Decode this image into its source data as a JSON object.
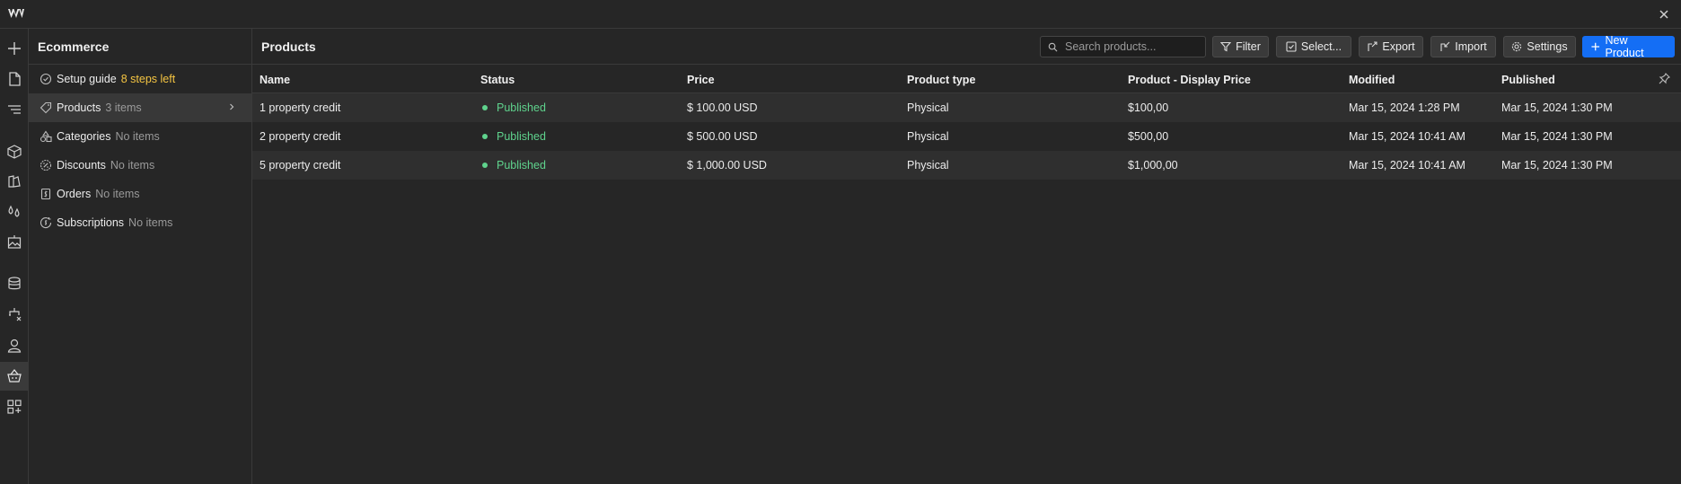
{
  "colors": {
    "accent": "#146ef5",
    "published": "#5fd38d",
    "warning": "#f5c542"
  },
  "sidebar": {
    "title": "Ecommerce",
    "items": [
      {
        "label": "Setup guide",
        "count": "8 steps left",
        "icon": "check-circle-icon"
      },
      {
        "label": "Products",
        "count": "3 items",
        "icon": "tag-icon"
      },
      {
        "label": "Categories",
        "count": "No items",
        "icon": "categories-icon"
      },
      {
        "label": "Discounts",
        "count": "No items",
        "icon": "discount-icon"
      },
      {
        "label": "Orders",
        "count": "No items",
        "icon": "orders-icon"
      },
      {
        "label": "Subscriptions",
        "count": "No items",
        "icon": "subscriptions-icon"
      }
    ]
  },
  "rail": [
    "add-icon",
    "page-icon",
    "navigator-icon",
    "components-icon",
    "style-icon",
    "variables-icon",
    "assets-icon",
    "cms-icon",
    "logic-icon",
    "users-icon",
    "ecommerce-icon",
    "apps-icon"
  ],
  "main": {
    "title": "Products",
    "search_placeholder": "Search products...",
    "buttons": {
      "filter": "Filter",
      "select": "Select...",
      "export": "Export",
      "import": "Import",
      "settings": "Settings",
      "new_product": "New Product"
    }
  },
  "table": {
    "columns": [
      "Name",
      "Status",
      "Price",
      "Product type",
      "Product - Display Price",
      "Modified",
      "Published"
    ],
    "rows": [
      [
        "1 property credit",
        "Published",
        "$ 100.00 USD",
        "Physical",
        "$100,00",
        "Mar 15, 2024 1:28 PM",
        "Mar 15, 2024 1:30 PM"
      ],
      [
        "2 property credit",
        "Published",
        "$ 500.00 USD",
        "Physical",
        "$500,00",
        "Mar 15, 2024 10:41 AM",
        "Mar 15, 2024 1:30 PM"
      ],
      [
        "5 property credit",
        "Published",
        "$ 1,000.00 USD",
        "Physical",
        "$1,000,00",
        "Mar 15, 2024 10:41 AM",
        "Mar 15, 2024 1:30 PM"
      ]
    ]
  }
}
